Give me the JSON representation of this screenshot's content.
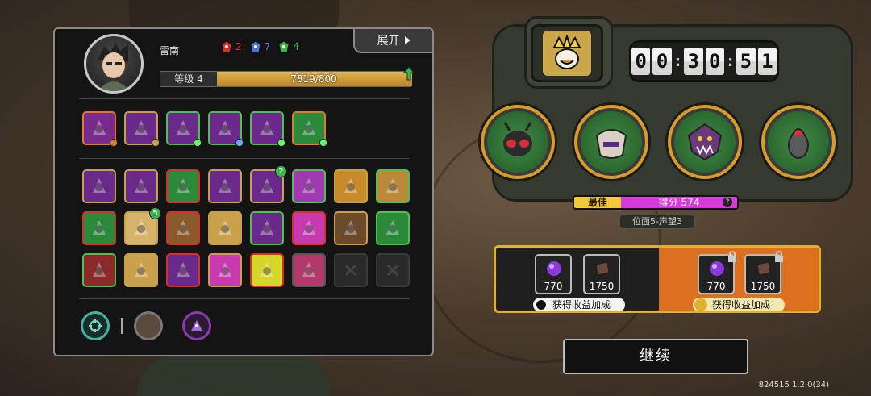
{
  "character": {
    "name": "雷南",
    "level_label": "等级 4",
    "xp_text": "7819/800",
    "xp_fraction": 1.0
  },
  "runes": [
    {
      "icon": "red-rune-icon",
      "color": "#d9302a",
      "count": "2"
    },
    {
      "icon": "blue-rune-icon",
      "color": "#4a7ae0",
      "count": "7"
    },
    {
      "icon": "green-rune-icon",
      "color": "#3eb54a",
      "count": "4"
    }
  ],
  "expand_button": "展开",
  "skill_rows": [
    [
      {
        "icon": "cross-claw-icon",
        "bg": "#7a2a8a",
        "border": "#e07a2a",
        "dot": "#e07a2a"
      },
      {
        "icon": "eye-crystal-icon",
        "bg": "#6a2a8a",
        "border": "#c8a14a",
        "dot": "#c8a14a"
      },
      {
        "icon": "dark-orb-icon",
        "bg": "#6a2a8a",
        "border": "#4ec24e",
        "dot": "#6f6"
      },
      {
        "icon": "blade-icon",
        "bg": "#6a2a8a",
        "border": "#4ec24e",
        "dot": "#6af"
      },
      {
        "icon": "hooded-figure-icon",
        "bg": "#6a2a8a",
        "border": "#4ec24e",
        "dot": "#6f6"
      },
      {
        "icon": "syringe-icon",
        "bg": "#2a8a3a",
        "border": "#e07a2a",
        "dot": "#6f6"
      }
    ],
    [
      {
        "icon": "claw-scroll-icon",
        "bg": "#6a2a8a",
        "border": "#c8a14a",
        "badge": ""
      },
      {
        "icon": "mask-icon",
        "bg": "#6a2a8a",
        "border": "#c8a14a",
        "badge": ""
      },
      {
        "icon": "shield-icon",
        "bg": "#2a8a3a",
        "border": "#d9302a",
        "badge": ""
      },
      {
        "icon": "spine-icon",
        "bg": "#6a2a8a",
        "border": "#c8a14a",
        "badge": ""
      },
      {
        "icon": "spiky-virus-icon",
        "bg": "#6a2a8a",
        "border": "#c8a14a",
        "badge": "2"
      },
      {
        "icon": "tendril-icon",
        "bg": "#a03ab0",
        "border": "#4ec24e",
        "badge": ""
      },
      {
        "icon": "gear-eye-icon",
        "bg": "#c88a2a",
        "border": "#c8a14a",
        "badge": ""
      },
      {
        "icon": "explosion-icon",
        "bg": "#b88a3a",
        "border": "#4ec24e",
        "badge": ""
      }
    ],
    [
      {
        "icon": "green-slash-icon",
        "bg": "#2a8a3a",
        "border": "#d9302a",
        "badge": ""
      },
      {
        "icon": "sunrise-icon",
        "bg": "#d6b36a",
        "border": "#c8a14a",
        "badge": "5"
      },
      {
        "icon": "gold-emblem-icon",
        "bg": "#8a5a2a",
        "border": "#d9302a",
        "badge": ""
      },
      {
        "icon": "sun-gear-icon",
        "bg": "#c8a14a",
        "border": "#c8a14a",
        "badge": ""
      },
      {
        "icon": "scorpion-icon",
        "bg": "#6a2a8a",
        "border": "#4ec24e",
        "badge": ""
      },
      {
        "icon": "pink-flower-icon",
        "bg": "#c83ab0",
        "border": "#d9302a",
        "badge": ""
      },
      {
        "icon": "crack-icon",
        "bg": "#6a4a2a",
        "border": "#c8a14a",
        "badge": ""
      },
      {
        "icon": "green-plus-icon",
        "bg": "#2a8a3a",
        "border": "#4ec24e",
        "badge": ""
      }
    ],
    [
      {
        "icon": "red-figure-icon",
        "bg": "#8a2a2a",
        "border": "#4ec24e",
        "badge": ""
      },
      {
        "icon": "chain-icon",
        "bg": "#c8a14a",
        "border": "#c8a14a",
        "badge": ""
      },
      {
        "icon": "crossed-swords-icon",
        "bg": "#6a2a8a",
        "border": "#d9302a",
        "badge": ""
      },
      {
        "icon": "pink-rune-icon",
        "bg": "#c83ab0",
        "border": "#c8a14a",
        "badge": ""
      },
      {
        "icon": "burst-icon",
        "bg": "#d6d62a",
        "border": "#d9302a",
        "badge": ""
      },
      {
        "icon": "red-burst-icon",
        "bg": "#b03a6a",
        "border": "#555",
        "badge": ""
      },
      {
        "icon": "empty-slot-icon",
        "bg": "",
        "border": "",
        "badge": "",
        "empty": true
      },
      {
        "icon": "empty-slot-icon",
        "bg": "",
        "border": "",
        "badge": "",
        "empty": true
      }
    ]
  ],
  "timer": {
    "h1": "0",
    "h2": "0",
    "m1": "3",
    "m2": "0",
    "s1": "5",
    "s2": "1"
  },
  "enemies": [
    "moth-boss-icon",
    "armored-beetle-icon",
    "fanged-demon-icon",
    "horned-larva-icon"
  ],
  "score": {
    "best_label": "最佳",
    "score_text": "得分 574",
    "help": "?"
  },
  "position_label": "位面5-声望3",
  "rewards": {
    "base": [
      {
        "icon": "purple-orb-icon",
        "value": "770"
      },
      {
        "icon": "brown-tile-icon",
        "value": "1750"
      }
    ],
    "bonus": [
      {
        "icon": "purple-orb-icon",
        "value": "770"
      },
      {
        "icon": "brown-tile-icon",
        "value": "1750"
      }
    ],
    "left_button": "获得收益加成",
    "right_button": "获得收益加成"
  },
  "continue_label": "继续",
  "version": "824515 1.2.0(34)"
}
